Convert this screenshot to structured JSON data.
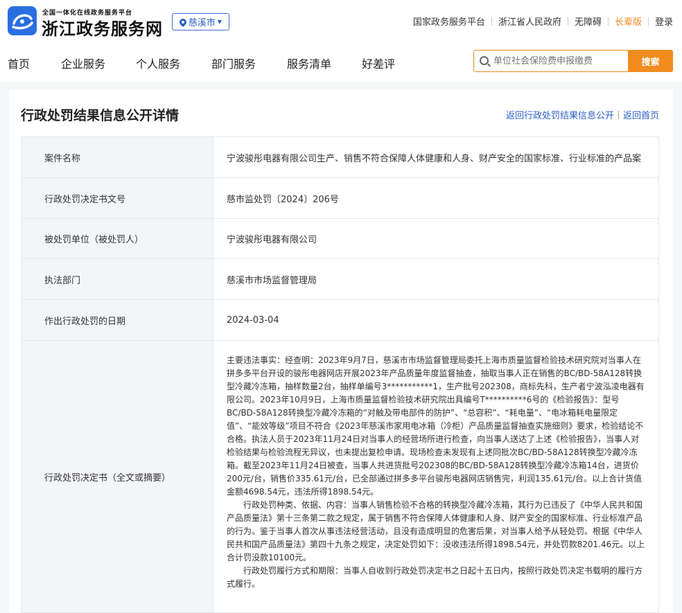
{
  "header": {
    "logo_sub": "全国一体化在线政务服务平台",
    "logo_main": "浙江政务服务网",
    "city": "慈溪市",
    "links": [
      "国家政务服务平台",
      "浙江省人民政府",
      "无障碍",
      "长辈版",
      "登录"
    ]
  },
  "nav": {
    "items": [
      "首页",
      "企业服务",
      "个人服务",
      "部门服务",
      "服务清单",
      "好差评"
    ],
    "search_placeholder": "单位社会保险费申报缴费",
    "search_button": "搜索"
  },
  "page": {
    "title": "行政处罚结果信息公开详情",
    "back_list": "返回行政处罚结果信息公开",
    "back_home": "返回首页"
  },
  "details": {
    "case_name_label": "案件名称",
    "case_name": "宁波骏彤电器有限公司生产、销售不符合保障人体健康和人身、财产安全的国家标准、行业标准的产品案",
    "doc_no_label": "行政处罚决定书文号",
    "doc_no": "慈市监处罚〔2024〕206号",
    "party_label": "被处罚单位（被处罚人）",
    "party": "宁波骏彤电器有限公司",
    "dept_label": "执法部门",
    "dept": "慈溪市市场监督管理局",
    "date_label": "作出行政处罚的日期",
    "date": "2024-03-04",
    "decision_label": "行政处罚决定书（全文或摘要）",
    "decision_p1": "主要违法事实：经查明：2023年9月7日，慈溪市市场监督管理局委托上海市质量监督检验技术研究院对当事人在拼多多平台开设的骏彤电器网店开展2023年产品质量年度监督抽查，抽取当事人正在销售的BC/BD-58A128转换型冷藏冷冻箱，抽样数量2台，抽样单编号3***********1，生产批号202308，商标先科，生产者宁波泓凌电器有限公司。2023年10月9日，上海市质量监督检验技术研究院出具编号T**********6号的《检验报告》：型号BC/BD-58A128转换型冷藏冷冻箱的“对触及带电部件的防护”、“总容积”、“耗电量”、“电冰箱耗电量限定值”、“能效等级”项目不符合《2023年慈溪市家用电冰箱（冷柜）产品质量监督抽查实施细则》要求，检验结论不合格。执法人员于2023年11月24日对当事人的经营场所进行检查，向当事人送达了上述《检验报告》，当事人对检验结果与检验流程无异议，也未提出复检申请。现场检查未发现有上述同批次BC/BD-58A128转换型冷藏冷冻箱。截至2023年11月24日被查，当事人共进货批号202308的BC/BD-58A128转换型冷藏冷冻箱14台，进货价200元/台，销售价335.61元/台，已全部通过拼多多平台骏彤电器网店销售完，利润135.61元/台。以上合计货值金额4698.54元，违法所得1898.54元。",
    "decision_p2": "行政处罚种类、依据、内容：当事人销售检验不合格的转换型冷藏冷冻箱，其行为已违反了《中华人民共和国产品质量法》第十三条第二款之规定，属于销售不符合保障人体健康和人身、财产安全的国家标准、行业标准产品的行为。鉴于当事人首次从事违法经营活动，且没有造成明显的危害后果，对当事人给予从轻处罚。根据《中华人民共和国产品质量法》第四十九条之规定，决定处罚如下：没收违法所得1898.54元，并处罚款8201.46元。以上合计罚没款10100元。",
    "decision_p3": "行政处罚履行方式和期限：当事人自收到行政处罚决定书之日起十五日内，按照行政处罚决定书载明的履行方式履行。"
  }
}
